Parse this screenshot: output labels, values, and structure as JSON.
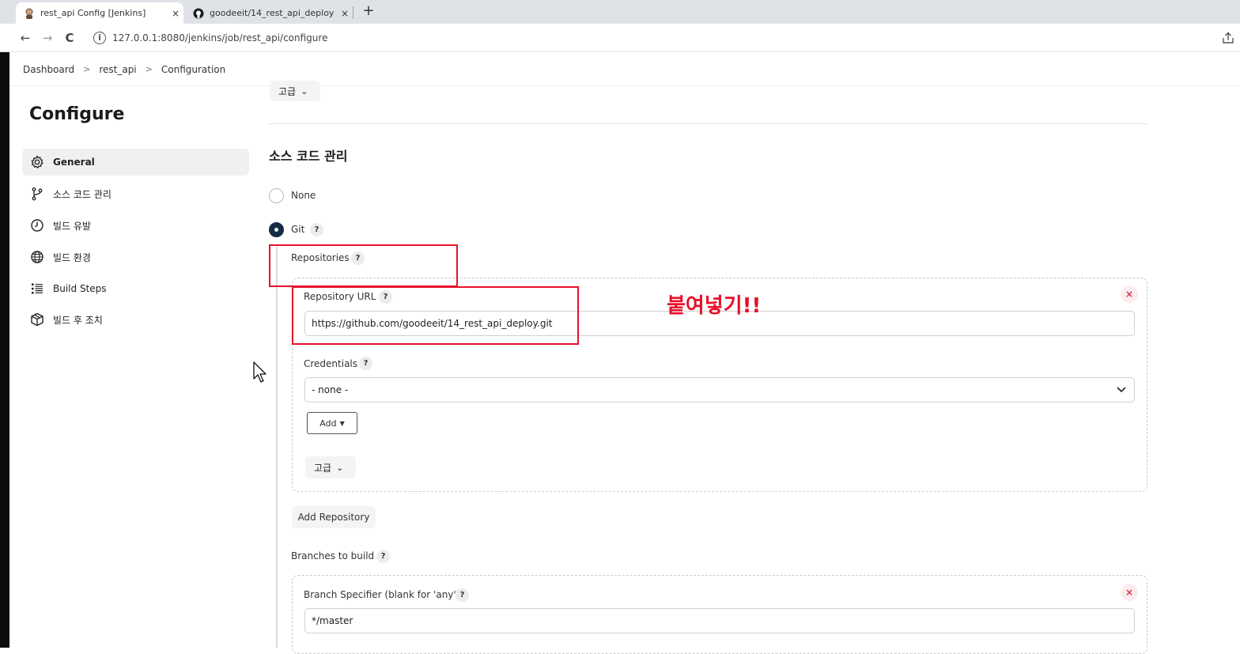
{
  "browser": {
    "tabs": [
      {
        "title": "rest_api Config [Jenkins]",
        "close": "×"
      },
      {
        "title": "goodeeit/14_rest_api_deploy",
        "close": "×"
      }
    ],
    "new_tab": "+",
    "url": "127.0.0.1:8080/jenkins/job/rest_api/configure",
    "nav": {
      "back": "←",
      "forward": "→",
      "reload": "C",
      "info": "i"
    }
  },
  "breadcrumb": {
    "items": [
      "Dashboard",
      "rest_api",
      "Configuration"
    ],
    "separator": ">"
  },
  "sidebar": {
    "title": "Configure",
    "items": [
      {
        "label": "General",
        "icon": "gear-icon",
        "active": true
      },
      {
        "label": "소스 코드 관리",
        "icon": "branch-icon"
      },
      {
        "label": "빌드 유발",
        "icon": "clock-icon"
      },
      {
        "label": "빌드 환경",
        "icon": "globe-icon"
      },
      {
        "label": "Build Steps",
        "icon": "list-icon"
      },
      {
        "label": "빌드 후 조치",
        "icon": "box-icon"
      }
    ]
  },
  "main": {
    "advanced_top": "고급",
    "scm_title": "소스 코드 관리",
    "radio_none": "None",
    "radio_git": "Git",
    "help": "?",
    "repositories_label": "Repositories",
    "repo_url_label": "Repository URL",
    "repo_url_value": "https://github.com/goodeeit/14_rest_api_deploy.git",
    "credentials_label": "Credentials",
    "credentials_value": "- none -",
    "add_button": "Add",
    "advanced_repo": "고급",
    "add_repository": "Add Repository",
    "branches_label": "Branches to build",
    "branch_specifier_label": "Branch Specifier (blank for 'any')",
    "branch_specifier_value": "*/master",
    "remove": "×"
  },
  "annotation": {
    "text": "붙여넣기!!",
    "color": "#e8102a"
  },
  "colors": {
    "radio_checked": "#142b48",
    "remove_button": "#d2374b"
  }
}
